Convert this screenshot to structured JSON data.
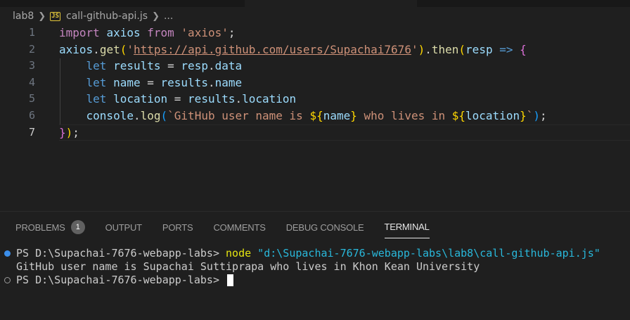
{
  "breadcrumb": {
    "folder": "lab8",
    "file_badge": "JS",
    "file": "call-github-api.js",
    "more": "..."
  },
  "editor": {
    "line_numbers": [
      "1",
      "2",
      "3",
      "4",
      "5",
      "6",
      "7"
    ],
    "tokens": {
      "l1_import": "import",
      "l1_axios": "axios",
      "l1_from": "from",
      "l1_module": "'axios'",
      "l1_semi": ";",
      "l2_axios": "axios",
      "l2_dot": ".",
      "l2_get": "get",
      "l2_paren": "(",
      "l2_q1": "'",
      "l2_url": "https://api.github.com/users/Supachai7676",
      "l2_q2": "'",
      "l2_paren2": ")",
      "l2_dot2": ".",
      "l2_then": "then",
      "l2_paren3": "(",
      "l2_resp": "resp",
      "l2_arrow": " => ",
      "l2_brace": "{",
      "l3_let": "let",
      "l3_results": "results",
      "l3_eq": " = ",
      "l3_resp": "resp",
      "l3_dot": ".",
      "l3_data": "data",
      "l4_let": "let",
      "l4_name": "name",
      "l4_eq": " = ",
      "l4_results": "results",
      "l4_dot": ".",
      "l4_prop": "name",
      "l5_let": "let",
      "l5_location": "location",
      "l5_eq": " = ",
      "l5_results": "results",
      "l5_dot": ".",
      "l5_prop": "location",
      "l6_console": "console",
      "l6_dot": ".",
      "l6_log": "log",
      "l6_paren": "(",
      "l6_s1": "`GitHub user name is ",
      "l6_i1o": "${",
      "l6_name": "name",
      "l6_i1c": "}",
      "l6_s2": " who lives in ",
      "l6_i2o": "${",
      "l6_loc": "location",
      "l6_i2c": "}",
      "l6_s3": "`",
      "l6_paren2": ")",
      "l6_semi": ";",
      "l7_brace": "}",
      "l7_paren": ")",
      "l7_semi": ";"
    }
  },
  "panel": {
    "tabs": [
      {
        "label": "PROBLEMS",
        "badge": "1"
      },
      {
        "label": "OUTPUT"
      },
      {
        "label": "PORTS"
      },
      {
        "label": "COMMENTS"
      },
      {
        "label": "DEBUG CONSOLE"
      },
      {
        "label": "TERMINAL",
        "active": true
      }
    ]
  },
  "terminal": {
    "prompt1": "PS D:\\Supachai-7676-webapp-labs> ",
    "cmd": "node",
    "arg": " \"d:\\Supachai-7676-webapp-labs\\lab8\\call-github-api.js\"",
    "output": "GitHub user name is Supachai Suttiprapa who lives in Khon Kean University",
    "prompt2": "PS D:\\Supachai-7676-webapp-labs> "
  },
  "colors": {
    "background": "#1f1f1f",
    "keyword": "#569cd6",
    "control": "#c586c0",
    "string": "#ce9178",
    "function": "#dcdcaa",
    "variable": "#9cdcfe",
    "terminal_cmd": "#e5e510",
    "terminal_str": "#29b8db"
  }
}
